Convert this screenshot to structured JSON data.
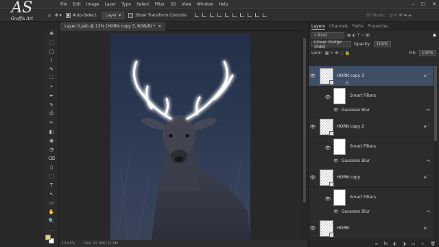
{
  "logo": {
    "monogram": "AS",
    "brand": "Graffix Art"
  },
  "menu": [
    "File",
    "Edit",
    "Image",
    "Layer",
    "Type",
    "Select",
    "Filter",
    "3D",
    "View",
    "Window",
    "Help"
  ],
  "window_controls": {
    "minimize": "–",
    "maximize": "☐",
    "close": "✕"
  },
  "options": {
    "auto_select_label": "Auto-Select:",
    "auto_select_target": "Layer",
    "transform_label": "Show Transform Controls",
    "mode_label": "3D Mode:"
  },
  "tools": [
    "✥",
    "⬚",
    "◯",
    "⌇",
    "✎",
    "⛶",
    "⌖",
    "✒",
    "✎",
    "⎙",
    "✂",
    "◧",
    "◉",
    "◔",
    "⌫",
    "▯",
    "⬚",
    "✎",
    "T",
    "↖",
    "▭",
    "✋",
    "🔍",
    "…"
  ],
  "document": {
    "tab_title": "Layer 0.psb @ 13% (HORN copy 3, RGB/8) *",
    "close": "×"
  },
  "status": {
    "zoom": "13.04%",
    "doc": "Doc: 47.0M/122.8M"
  },
  "panel": {
    "tabs": [
      "Layers",
      "Channels",
      "Paths",
      "Properties"
    ],
    "active_tab": "Layers",
    "filter_kind": "Kind",
    "blend_mode": "Linear Dodge (Add)",
    "opacity_label": "Opacity:",
    "opacity_value": "100%",
    "lock_label": "Lock:",
    "fill_label": "Fill:",
    "fill_value": "100%",
    "layers": [
      {
        "name": "HORN copy 3",
        "selected": true,
        "smart_filters": "Smart Filters",
        "filter": "Gaussian Blur"
      },
      {
        "name": "HORN copy 2",
        "selected": false,
        "smart_filters": "Smart Filters",
        "filter": "Gaussian Blur"
      },
      {
        "name": "HORN copy",
        "selected": false,
        "smart_filters": "Smart Filters",
        "filter": "Gaussian Blur"
      },
      {
        "name": "HORN",
        "selected": false
      }
    ],
    "bottom_icons": [
      "∞",
      "fx",
      "◐",
      "◑",
      "▭",
      "＋",
      "🗑"
    ]
  },
  "colors": {
    "foreground": "#e0d47c",
    "background": "#ffffff",
    "selection": "#3e4f66"
  }
}
